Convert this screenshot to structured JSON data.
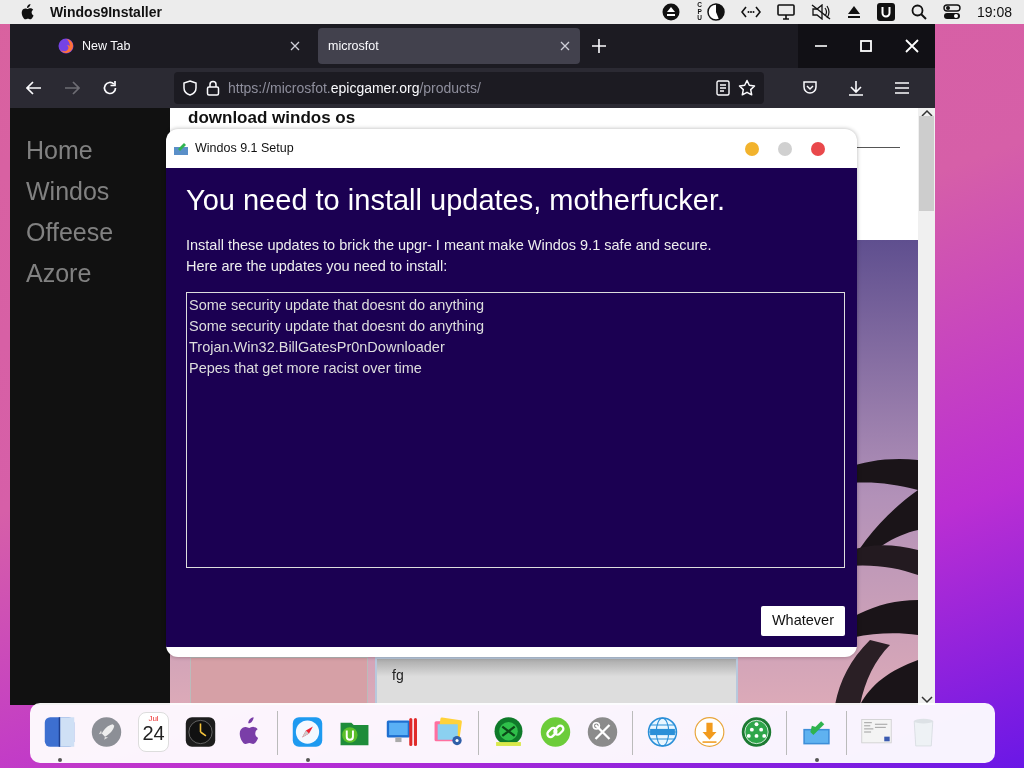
{
  "menubar": {
    "app_name": "Windos9Installer",
    "cpu_label": "CPU",
    "clock": "19:08"
  },
  "browser": {
    "tabs": [
      {
        "label": "New Tab",
        "selected": false
      },
      {
        "label": "microsfot",
        "selected": true
      }
    ],
    "url": {
      "prefix": "https://microsfot.",
      "domain": "epicgamer.org",
      "path": "/products/"
    }
  },
  "page": {
    "nav": [
      "Home",
      "Windos",
      "Offeese",
      "Azore"
    ],
    "heading": "download windos os",
    "card_text": "fg"
  },
  "dialog": {
    "title": "Windos 9.1 Setup",
    "heading": "You need to install updates, motherfucker.",
    "intro": [
      "Install these updates to brick the upgr- I meant make Windos 9.1 safe and secure.",
      "Here are the updates you need to install:"
    ],
    "updates": [
      "Some security update that doesnt do anything",
      "Some security update that doesnt do anything",
      "Trojan.Win32.BillGatesPr0nDownloader",
      "Pepes that get more racist over time"
    ],
    "button": "Whatever"
  },
  "dock": {
    "items": [
      {
        "kind": "finder",
        "running": true
      },
      {
        "kind": "rocket",
        "running": false
      },
      {
        "kind": "calendar",
        "running": false,
        "month": "Jul",
        "day": "24"
      },
      {
        "kind": "clock",
        "running": false
      },
      {
        "kind": "apple",
        "running": false
      },
      {
        "kind": "separator"
      },
      {
        "kind": "compass",
        "running": true
      },
      {
        "kind": "folder",
        "running": false
      },
      {
        "kind": "monitor",
        "running": false
      },
      {
        "kind": "photos",
        "running": false
      },
      {
        "kind": "separator"
      },
      {
        "kind": "sphere",
        "running": false
      },
      {
        "kind": "link",
        "running": false
      },
      {
        "kind": "tools",
        "running": false
      },
      {
        "kind": "separator"
      },
      {
        "kind": "globe",
        "running": false
      },
      {
        "kind": "download",
        "running": false
      },
      {
        "kind": "people",
        "running": false
      },
      {
        "kind": "separator"
      },
      {
        "kind": "installer",
        "running": true
      },
      {
        "kind": "separator"
      },
      {
        "kind": "screenshot",
        "running": false
      },
      {
        "kind": "trash",
        "running": false
      }
    ]
  }
}
